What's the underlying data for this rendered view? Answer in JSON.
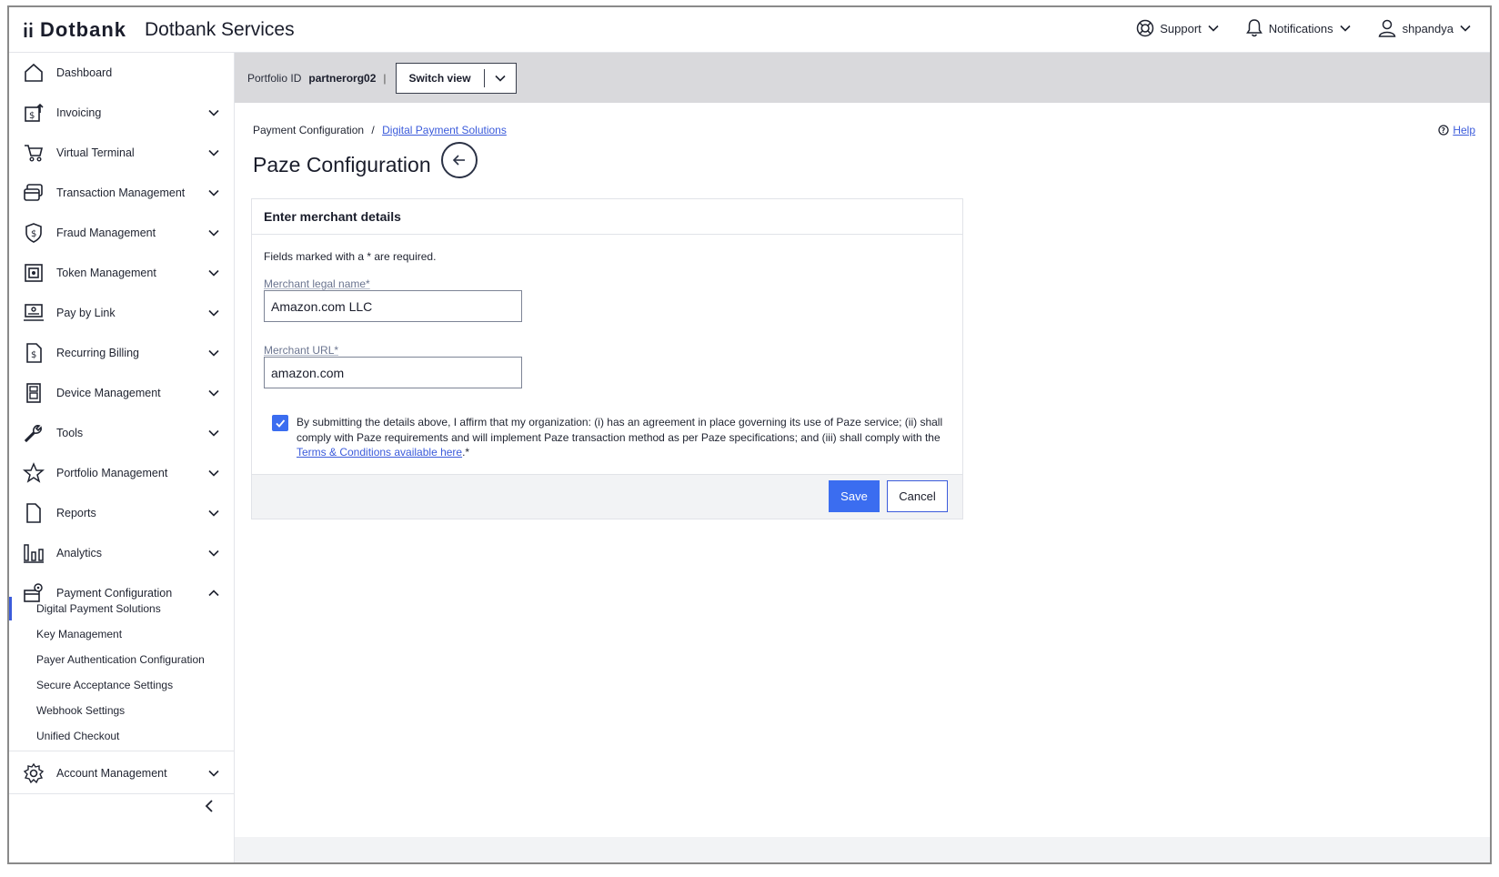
{
  "header": {
    "brand": "Dotbank",
    "app_title": "Dotbank Services",
    "support_label": "Support",
    "notifications_label": "Notifications",
    "user_label": "shpandya"
  },
  "sidebar": {
    "items": [
      {
        "label": "Dashboard",
        "icon": "home-icon"
      },
      {
        "label": "Invoicing",
        "icon": "invoice-icon"
      },
      {
        "label": "Virtual Terminal",
        "icon": "cart-icon"
      },
      {
        "label": "Transaction Management",
        "icon": "transaction-icon"
      },
      {
        "label": "Fraud Management",
        "icon": "shield-icon"
      },
      {
        "label": "Token Management",
        "icon": "token-icon"
      },
      {
        "label": "Pay by Link",
        "icon": "laptop-icon"
      },
      {
        "label": "Recurring Billing",
        "icon": "recurring-billing-icon"
      },
      {
        "label": "Device Management",
        "icon": "device-icon"
      },
      {
        "label": "Tools",
        "icon": "wrench-icon"
      },
      {
        "label": "Portfolio Management",
        "icon": "star-user-icon"
      },
      {
        "label": "Reports",
        "icon": "document-icon"
      },
      {
        "label": "Analytics",
        "icon": "analytics-icon"
      },
      {
        "label": "Payment Configuration",
        "icon": "payment-config-icon"
      }
    ],
    "sub_items": [
      "Digital Payment Solutions",
      "Key Management",
      "Payer Authentication Configuration",
      "Secure Acceptance Settings",
      "Webhook Settings",
      "Unified Checkout"
    ],
    "account_management": "Account Management"
  },
  "portfolio": {
    "label": "Portfolio ID",
    "value": "partnerorg02",
    "separator": "|",
    "switch_view": "Switch view"
  },
  "breadcrumb": {
    "parent": "Payment Configuration",
    "separator": "/",
    "current": "Digital Payment Solutions"
  },
  "help_label": "Help",
  "page_title": "Paze Configuration",
  "form": {
    "section_title": "Enter merchant details",
    "required_note": "Fields marked with a * are required.",
    "legal_name_label": "Merchant legal name*",
    "legal_name_value": "Amazon.com LLC",
    "url_label": "Merchant URL*",
    "url_value": "amazon.com",
    "affirm_checked": true,
    "affirm_text": "By submitting the details above, I affirm that my organization: (i) has an agreement in place governing its use of Paze service; (ii) shall comply with Paze requirements and will implement Paze transaction method as per Paze specifications; and (iii) shall comply with the",
    "affirm_link": "Terms & Conditions available here",
    "affirm_suffix": ".*",
    "save_label": "Save",
    "cancel_label": "Cancel"
  },
  "colors": {
    "accent": "#3b6df0",
    "link": "#3b5bdb",
    "portfolio_bar": "#d9d9dc"
  }
}
